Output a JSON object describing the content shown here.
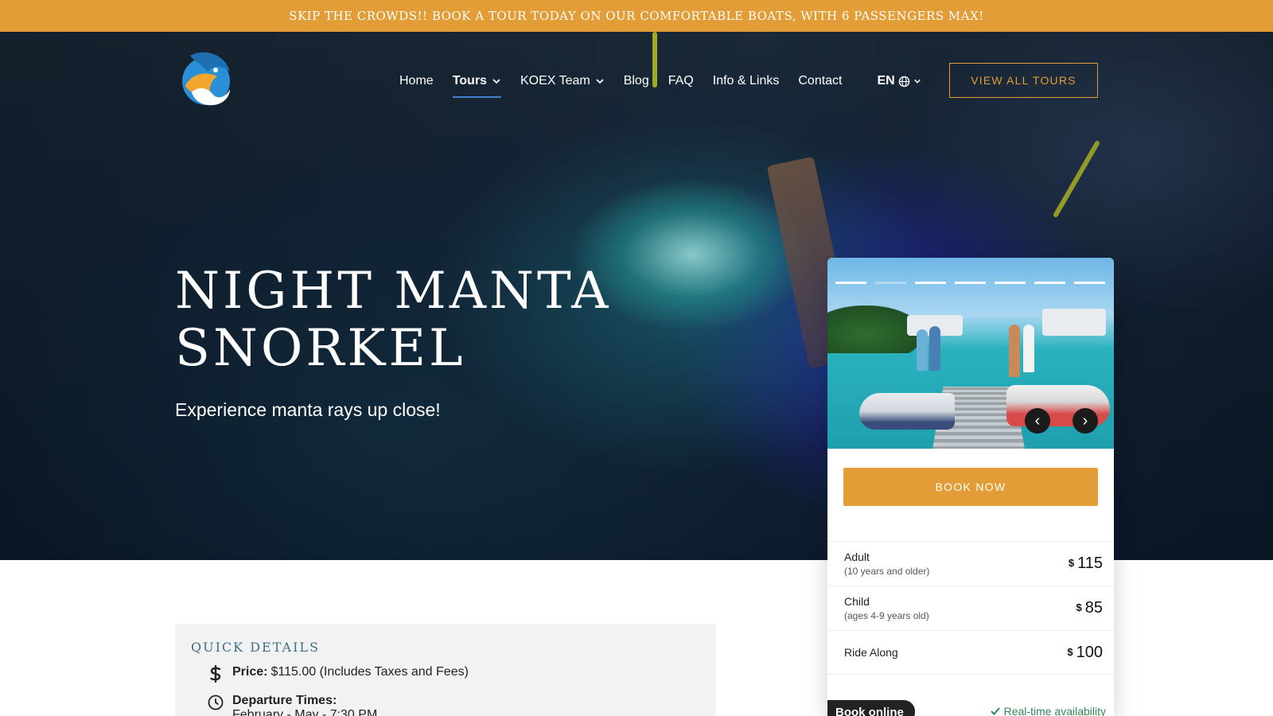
{
  "announcement": "SKIP THE CROWDS!! BOOK A TOUR TODAY ON OUR COMFORTABLE BOATS, WITH 6 PASSENGERS MAX!",
  "nav": {
    "items": [
      {
        "label": "Home",
        "active": false,
        "dropdown": false
      },
      {
        "label": "Tours",
        "active": true,
        "dropdown": true
      },
      {
        "label": "KOEX Team",
        "active": false,
        "dropdown": true
      },
      {
        "label": "Blog",
        "active": false,
        "dropdown": false
      },
      {
        "label": "FAQ",
        "active": false,
        "dropdown": false
      },
      {
        "label": "Info & Links",
        "active": false,
        "dropdown": false
      },
      {
        "label": "Contact",
        "active": false,
        "dropdown": false
      }
    ],
    "language": "EN",
    "cta": "VIEW ALL TOURS"
  },
  "hero": {
    "title": "Night Manta Snorkel",
    "subtitle": "Experience manta rays up close!"
  },
  "booking": {
    "gallery": {
      "slide_count": 7,
      "current_slide": 2,
      "prev": "‹",
      "next": "›"
    },
    "book_now": "BOOK NOW",
    "prices": [
      {
        "label": "Adult",
        "note": "(10 years and older)",
        "currency": "$",
        "value": "115"
      },
      {
        "label": "Child",
        "note": "(ages 4-9 years old)",
        "currency": "$",
        "value": "85"
      },
      {
        "label": "Ride Along",
        "note": "",
        "currency": "$",
        "value": "100"
      }
    ],
    "book_online": "Book online",
    "realtime": "Real-time availability"
  },
  "quick_details": {
    "title": "Quick Details",
    "price_label": "Price:",
    "price_value": "$115.00 (Includes Taxes and Fees)",
    "departure_label": "Departure Times:",
    "departure_value": "February - May - 7:30 PM"
  },
  "colors": {
    "accent": "#e29d36",
    "nav_underline": "#4a7fd0",
    "quick_title": "#3d6f86",
    "availability": "#2e8b57"
  }
}
